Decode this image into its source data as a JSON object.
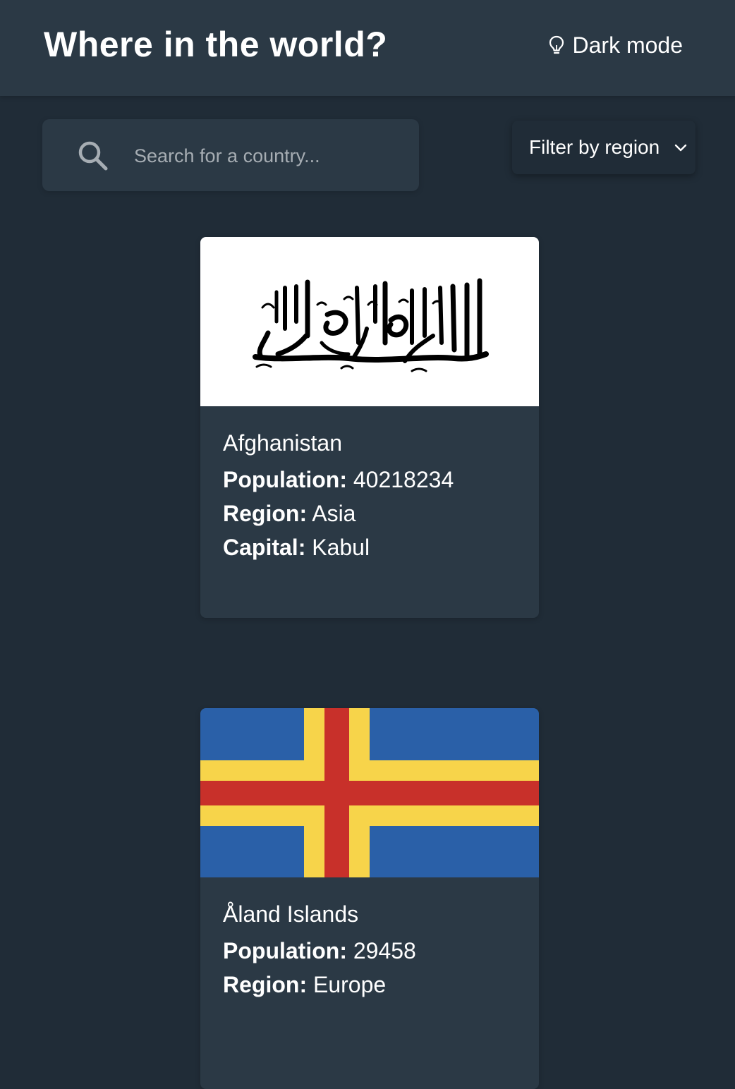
{
  "header": {
    "title": "Where in the world?",
    "theme_toggle_label": "Dark mode"
  },
  "search": {
    "placeholder": "Search for a country...",
    "value": ""
  },
  "filter": {
    "label": "Filter by region"
  },
  "field_labels": {
    "population": "Population:",
    "region": "Region:",
    "capital": "Capital:"
  },
  "countries": [
    {
      "name": "Afghanistan",
      "population": "40218234",
      "region": "Asia",
      "capital": "Kabul",
      "flag_colors": [
        "#ffffff",
        "#000000"
      ]
    },
    {
      "name": "Åland Islands",
      "population": "29458",
      "region": "Europe",
      "flag_colors": [
        "#2a60a8",
        "#f7d44a",
        "#c8302a"
      ]
    }
  ],
  "colors": {
    "background": "#202c37",
    "elements": "#2b3945",
    "text": "#ffffff",
    "placeholder": "#a6adb3"
  }
}
